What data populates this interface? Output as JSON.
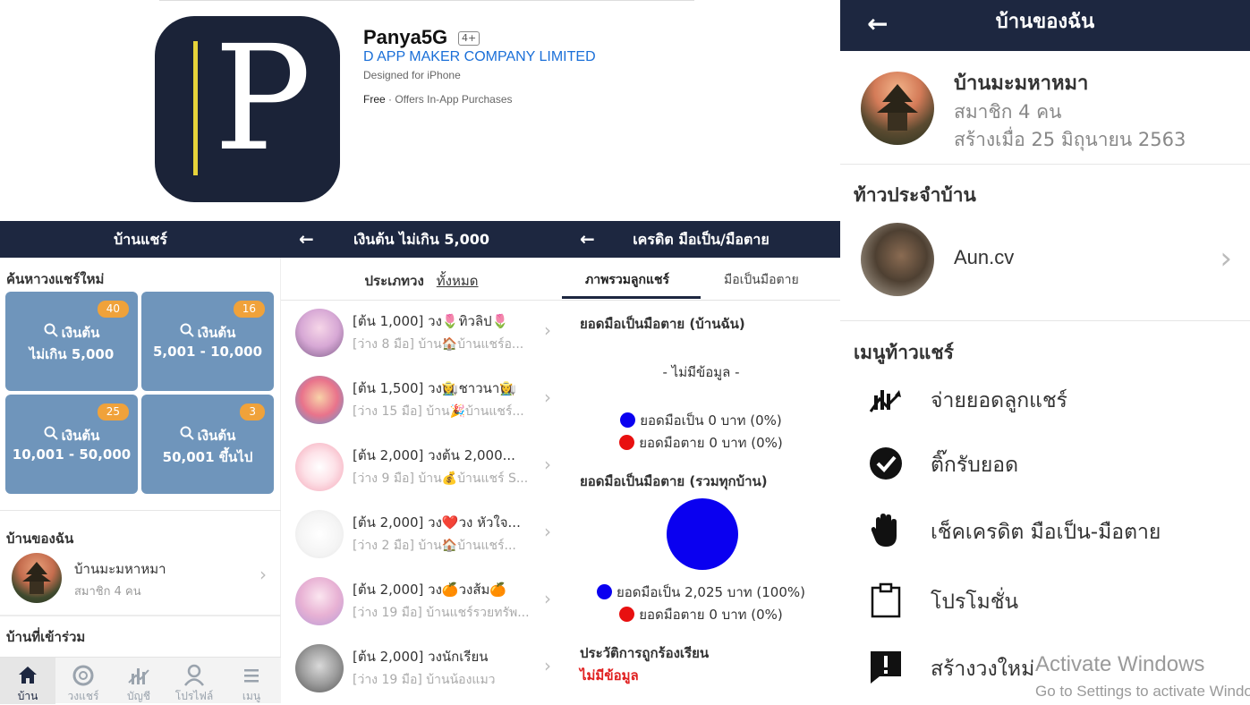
{
  "appstore": {
    "title": "Panya5G",
    "age_rating": "4+",
    "developer": "D APP MAKER COMPANY LIMITED",
    "designed_for": "Designed for iPhone",
    "price": "Free",
    "price_note": " · Offers In-App Purchases",
    "icon_letter": "P"
  },
  "screen1": {
    "title": "บ้านแชร์",
    "search_section": "ค้นหาวงแชร์ใหม่",
    "tiles": [
      {
        "badge": "40",
        "label": "เงินต้น",
        "range": "ไม่เกิน 5,000"
      },
      {
        "badge": "16",
        "label": "เงินต้น",
        "range": "5,001 - 10,000"
      },
      {
        "badge": "25",
        "label": "เงินต้น",
        "range": "10,001 - 50,000"
      },
      {
        "badge": "3",
        "label": "เงินต้น",
        "range": "50,001 ขึ้นไป"
      }
    ],
    "my_house_section": "บ้านของฉัน",
    "my_house": {
      "name": "บ้านมะมหาหมา",
      "members": "สมาชิก 4 คน"
    },
    "joined_section": "บ้านที่เข้าร่วม",
    "tabbar": [
      {
        "label": "บ้าน",
        "icon": "home-icon"
      },
      {
        "label": "วงแชร์",
        "icon": "lifebuoy-icon"
      },
      {
        "label": "บัญชี",
        "icon": "chart-icon"
      },
      {
        "label": "โปรไฟล์",
        "icon": "person-icon"
      },
      {
        "label": "เมนู",
        "icon": "menu-icon"
      }
    ]
  },
  "screen2": {
    "title": "เงินต้น ไม่เกิน 5,000",
    "filter_label": "ประเภทวง",
    "filter_value": "ทั้งหมด",
    "items": [
      {
        "line1": "[ต้น 1,000] วง🌷ทิวลิป🌷",
        "line2": "[ว่าง 8 มือ] บ้าน🏠บ้านแชร์อ..."
      },
      {
        "line1": "[ต้น 1,500] วง👩‍🌾ชาวนา👩‍🌾",
        "line2": "[ว่าง 15 มือ] บ้าน🎉บ้านแชร์..."
      },
      {
        "line1": "[ต้น 2,000] วงต้น 2,000...",
        "line2": "[ว่าง 9 มือ] บ้าน💰บ้านแชร์ S..."
      },
      {
        "line1": "[ต้น 2,000] วง❤️วง หัวใจ...",
        "line2": "[ว่าง 2 มือ] บ้าน🏠บ้านแชร์..."
      },
      {
        "line1": "[ต้น 2,000] วง🍊วงส้ม🍊",
        "line2": "[ว่าง 19 มือ] บ้านแชร์รวยทรัพ..."
      },
      {
        "line1": "[ต้น 2,000] วงนักเรียน",
        "line2": "[ว่าง 19 มือ] บ้านน้องแมว"
      }
    ]
  },
  "screen3": {
    "title": "เครดิต มือเป็น/มือตาย",
    "tab_active": "ภาพรวมลูกแชร์",
    "tab_other": "มือเป็นมือตาย",
    "section1_title": "ยอดมือเป็นมือตาย (บ้านฉัน)",
    "section1_nodata": "- ไม่มีข้อมูล -",
    "section1_live": "ยอดมือเป็น 0 บาท (0%)",
    "section1_dead": "ยอดมือตาย 0 บาท (0%)",
    "section2_title": "ยอดมือเป็นมือตาย (รวมทุกบ้าน)",
    "section2_live": "ยอดมือเป็น 2,025 บาท (100%)",
    "section2_dead": "ยอดมือตาย 0 บาท (0%)",
    "complaint_title": "ประวัติการถูกร้องเรียน",
    "complaint_value": "ไม่มีข้อมูล",
    "colors": {
      "live": "#0a00f0",
      "dead": "#e81010"
    },
    "chart_data": {
      "type": "pie",
      "categories": [
        "ยอดมือเป็น",
        "ยอดมือตาย"
      ],
      "values": [
        2025,
        0
      ]
    }
  },
  "screen4": {
    "title": "บ้านของฉัน",
    "house_name": "บ้านมะมหาหมา",
    "members": "สมาชิก 4 คน",
    "created": "สร้างเมื่อ 25 มิถุนายน 2563",
    "head_section": "ท้าวประจำบ้าน",
    "head_name": "Aun.cv",
    "menu_section": "เมนูท้าวแชร์",
    "menu": [
      {
        "label": "จ่ายยอดลูกแชร์",
        "icon": "payout-chart-icon"
      },
      {
        "label": "ติ๊กรับยอด",
        "icon": "check-circle-icon"
      },
      {
        "label": "เช็คเครดิต มือเป็น-มือตาย",
        "icon": "hand-icon"
      },
      {
        "label": "โปรโมชั่น",
        "icon": "clipboard-icon"
      },
      {
        "label": "สร้างวงใหม่",
        "icon": "alert-message-icon"
      }
    ]
  },
  "watermark": {
    "line1": "Activate Windows",
    "line2": "Go to Settings to activate Windows."
  }
}
